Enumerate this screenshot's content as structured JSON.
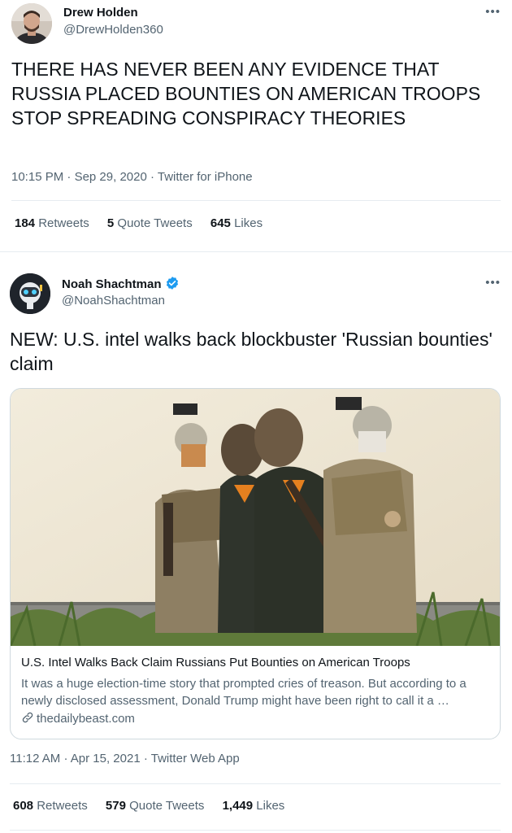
{
  "tweets": [
    {
      "author_name": "Drew Holden",
      "author_handle": "@DrewHolden360",
      "more_icon": "more-dots-icon",
      "text": "THERE HAS NEVER BEEN ANY EVIDENCE THAT RUSSIA PLACED BOUNTIES ON AMERICAN TROOPS STOP SPREADING CONSPIRACY THEORIES",
      "time": "10:15 PM",
      "date": "Sep 29, 2020",
      "source": "Twitter for iPhone",
      "stats": {
        "retweets_count": "184",
        "retweets_label": "Retweets",
        "quotes_count": "5",
        "quotes_label": "Quote Tweets",
        "likes_count": "645",
        "likes_label": "Likes"
      }
    },
    {
      "author_name": "Noah Shachtman",
      "author_handle": "@NoahShachtman",
      "verified": true,
      "more_icon": "more-dots-icon",
      "text": "NEW: U.S. intel walks back blockbuster 'Russian bounties' claim",
      "card": {
        "title": "U.S. Intel Walks Back Claim Russians Put Bounties on American Troops",
        "description": "It was a huge election-time story that prompted cries of treason. But according to a newly disclosed assessment, Donald Trump might have been right to call it a …",
        "domain": "thedailybeast.com"
      },
      "time": "11:12 AM",
      "date": "Apr 15, 2021",
      "source": "Twitter Web App",
      "stats": {
        "retweets_count": "608",
        "retweets_label": "Retweets",
        "quotes_count": "579",
        "quotes_label": "Quote Tweets",
        "likes_count": "1,449",
        "likes_label": "Likes"
      }
    }
  ],
  "meta_separator": "·",
  "colors": {
    "text_primary": "#0f1419",
    "text_secondary": "#536471",
    "divider": "#e6ecf0",
    "verified_blue": "#1d9bf0"
  }
}
